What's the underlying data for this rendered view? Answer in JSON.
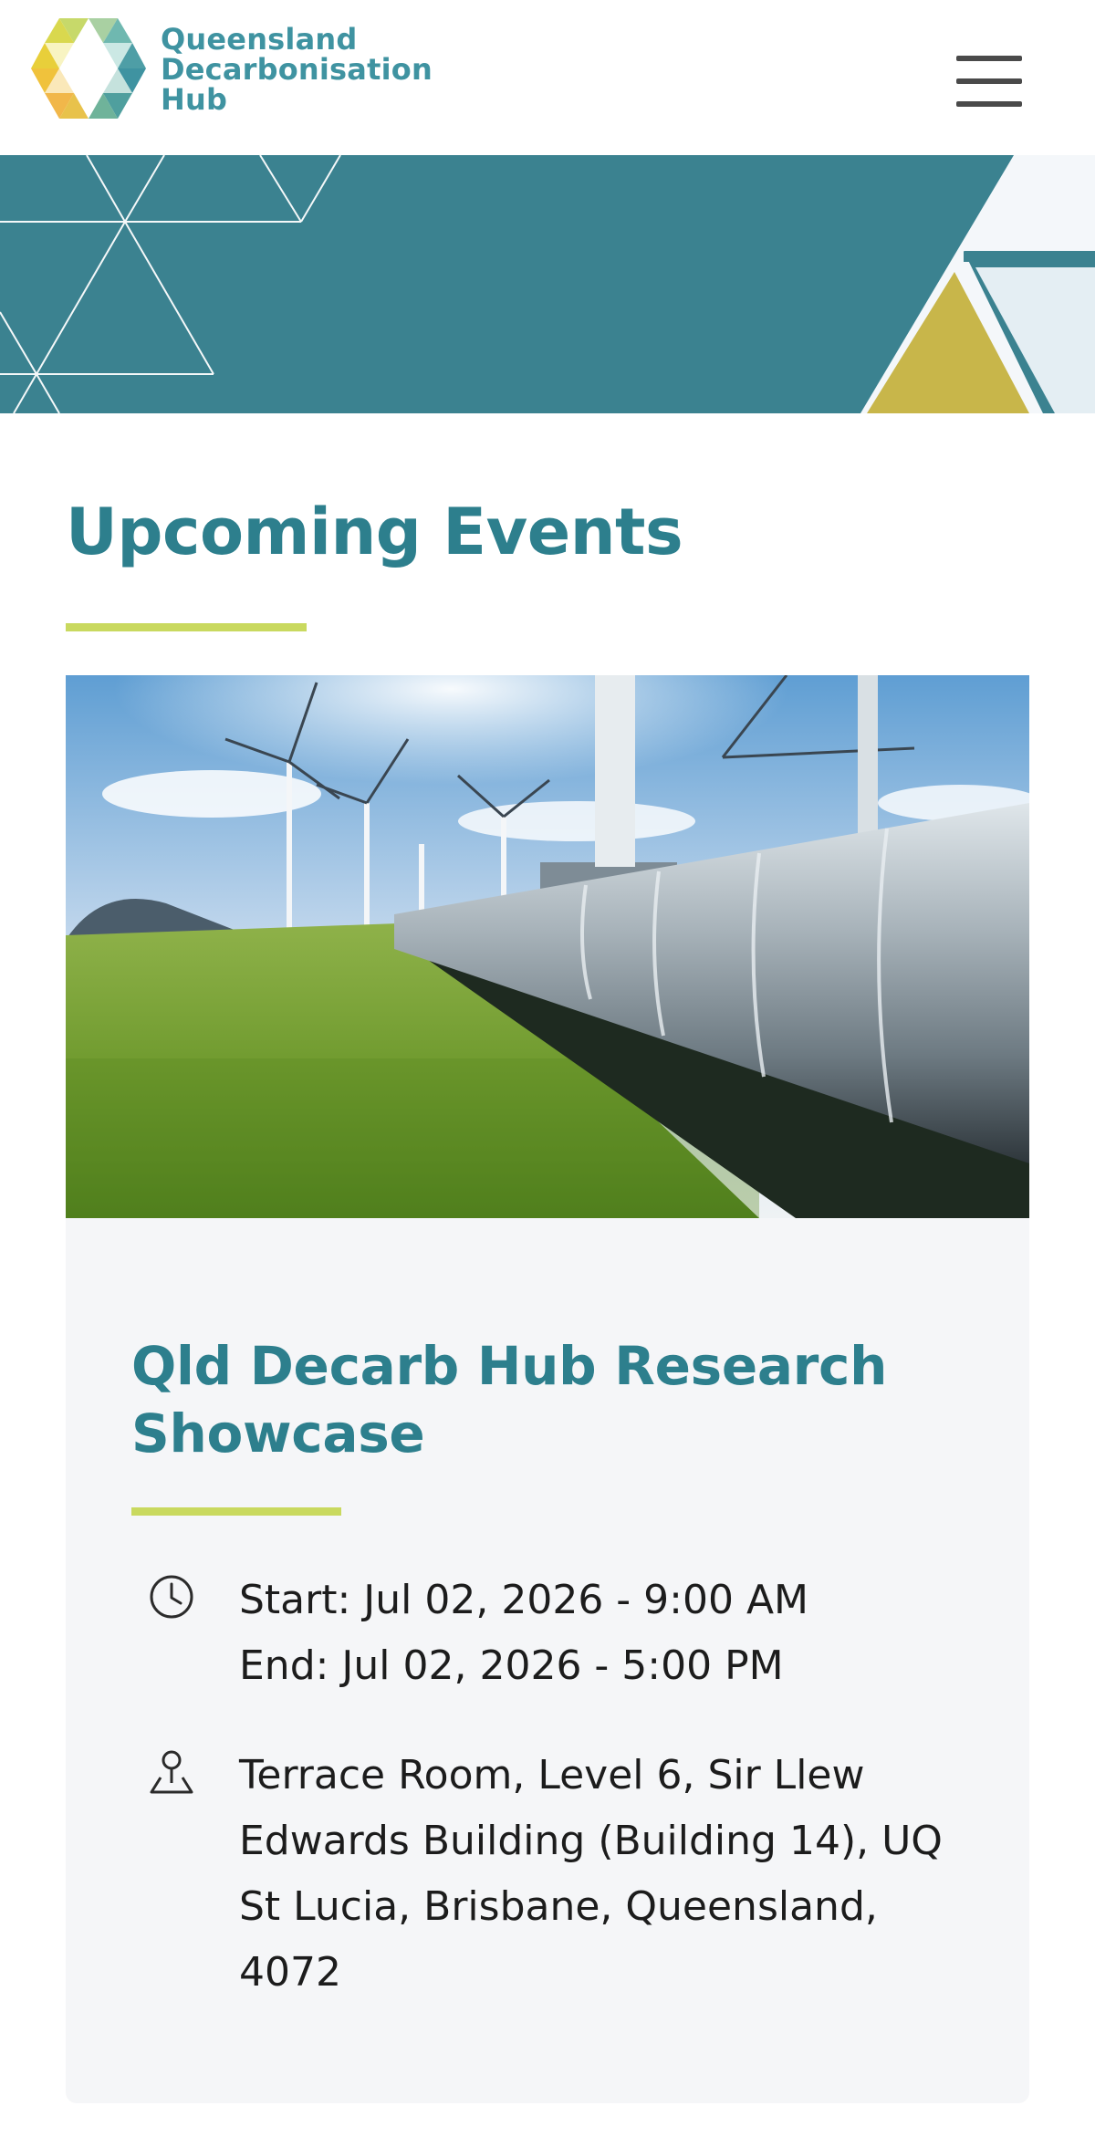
{
  "header": {
    "logo": {
      "line1": "Queensland",
      "line2": "Decarbonisation",
      "line3": "Hub"
    },
    "menu_icon": "hamburger-menu-icon"
  },
  "colors": {
    "teal": "#3b8290",
    "title_teal": "#2d7f8d",
    "accent_lime": "#c9d95f",
    "gold": "#c8b64a",
    "card_bg": "#f5f6f8"
  },
  "main": {
    "section_title": "Upcoming Events",
    "events": [
      {
        "image_alt": "",
        "title": "Qld Decarb Hub Research Showcase",
        "start": "Start: Jul 02, 2026 - 9:00 AM",
        "end": "End: Jul 02, 2026 - 5:00 PM",
        "location": "Terrace Room, Level 6, Sir Llew Edwards Building (Building 14), UQ St Lucia, Brisbane, Queensland, 4072",
        "time_icon": "clock-icon",
        "location_icon": "map-pin-icon"
      }
    ]
  }
}
